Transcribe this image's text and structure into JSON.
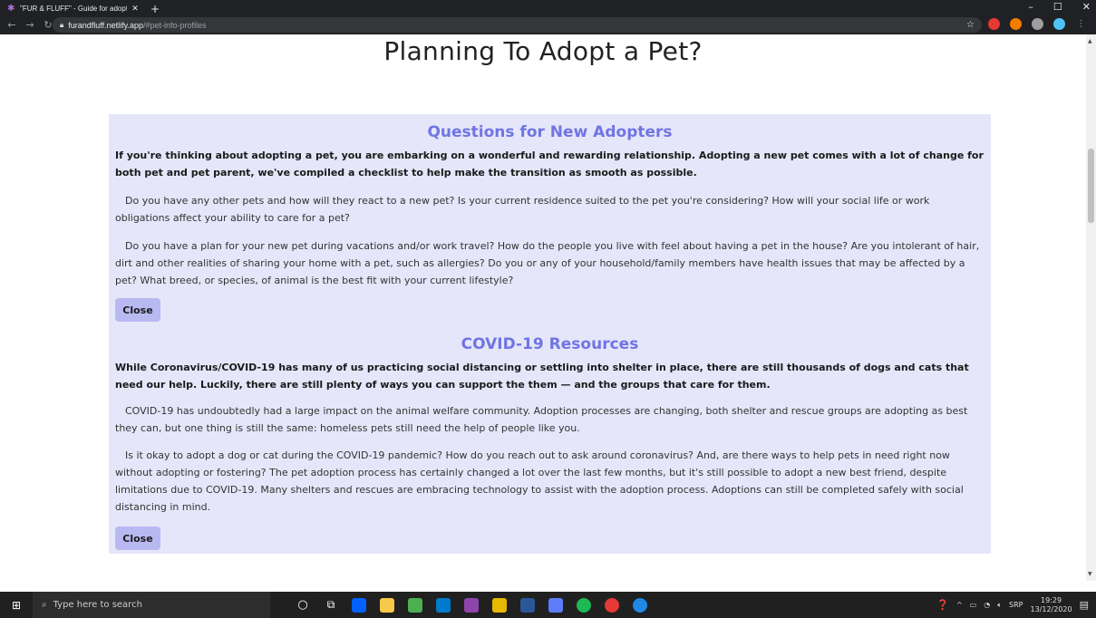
{
  "browser": {
    "tab_title": "\"FUR & FLUFF\" - Guide for adopt",
    "tab_close": "✕",
    "new_tab": "+",
    "url_host": "furandfluff.netlify.app",
    "url_path": "/#pet-info-profiles",
    "window_controls": {
      "minimize": "–",
      "maximize": "☐",
      "close": "✕"
    }
  },
  "page": {
    "title": "Planning To Adopt a Pet?",
    "sections": [
      {
        "heading": "Questions for New Adopters",
        "intro": "If you're thinking about adopting a pet, you are embarking on a wonderful and rewarding relationship. Adopting a new pet comes with a lot of change for both pet and pet parent, we've compiled a checklist to help make the transition as smooth as possible.",
        "paragraphs": [
          "Do you have any other pets and how will they react to a new pet? Is your current residence suited to the pet you're considering? How will your social life or work obligations affect your ability to care for a pet?",
          "Do you have a plan for your new pet during vacations and/or work travel? How do the people you live with feel about having a pet in the house? Are you intolerant of hair, dirt and other realities of sharing your home with a pet, such as allergies? Do you or any of your household/family members have health issues that may be affected by a pet? What breed, or species, of animal is the best fit with your current lifestyle?"
        ],
        "close_label": "Close"
      },
      {
        "heading": "COVID-19 Resources",
        "intro": "While Coronavirus/COVID-19 has many of us practicing social distancing or settling into shelter in place, there are still thousands of dogs and cats that need our help. Luckily, there are still plenty of ways you can support the them — and the groups that care for them.",
        "paragraphs": [
          "COVID-19 has undoubtedly had a large impact on the animal welfare community. Adoption processes are changing, both shelter and rescue groups are adopting as best they can, but one thing is still the same: homeless pets still need the help of people like you.",
          "Is it okay to adopt a dog or cat during the COVID-19 pandemic? How do you reach out to ask around coronavirus? And, are there ways to help pets in need right now without adopting or fostering? The pet adoption process has certainly changed a lot over the last few months, but it's still possible to adopt a new best friend, despite limitations due to COVID-19. Many shelters and rescues are embracing technology to assist with the adoption process. Adoptions can still be completed safely with social distancing in mind."
        ],
        "close_label": "Close"
      }
    ]
  },
  "taskbar": {
    "search_placeholder": "Type here to search",
    "language": "SRP",
    "time": "19:29",
    "date": "13/12/2020"
  },
  "colors": {
    "panel_bg": "#e6e6fa",
    "heading_accent": "#6f75e3",
    "button_bg": "#b9b9f2"
  }
}
